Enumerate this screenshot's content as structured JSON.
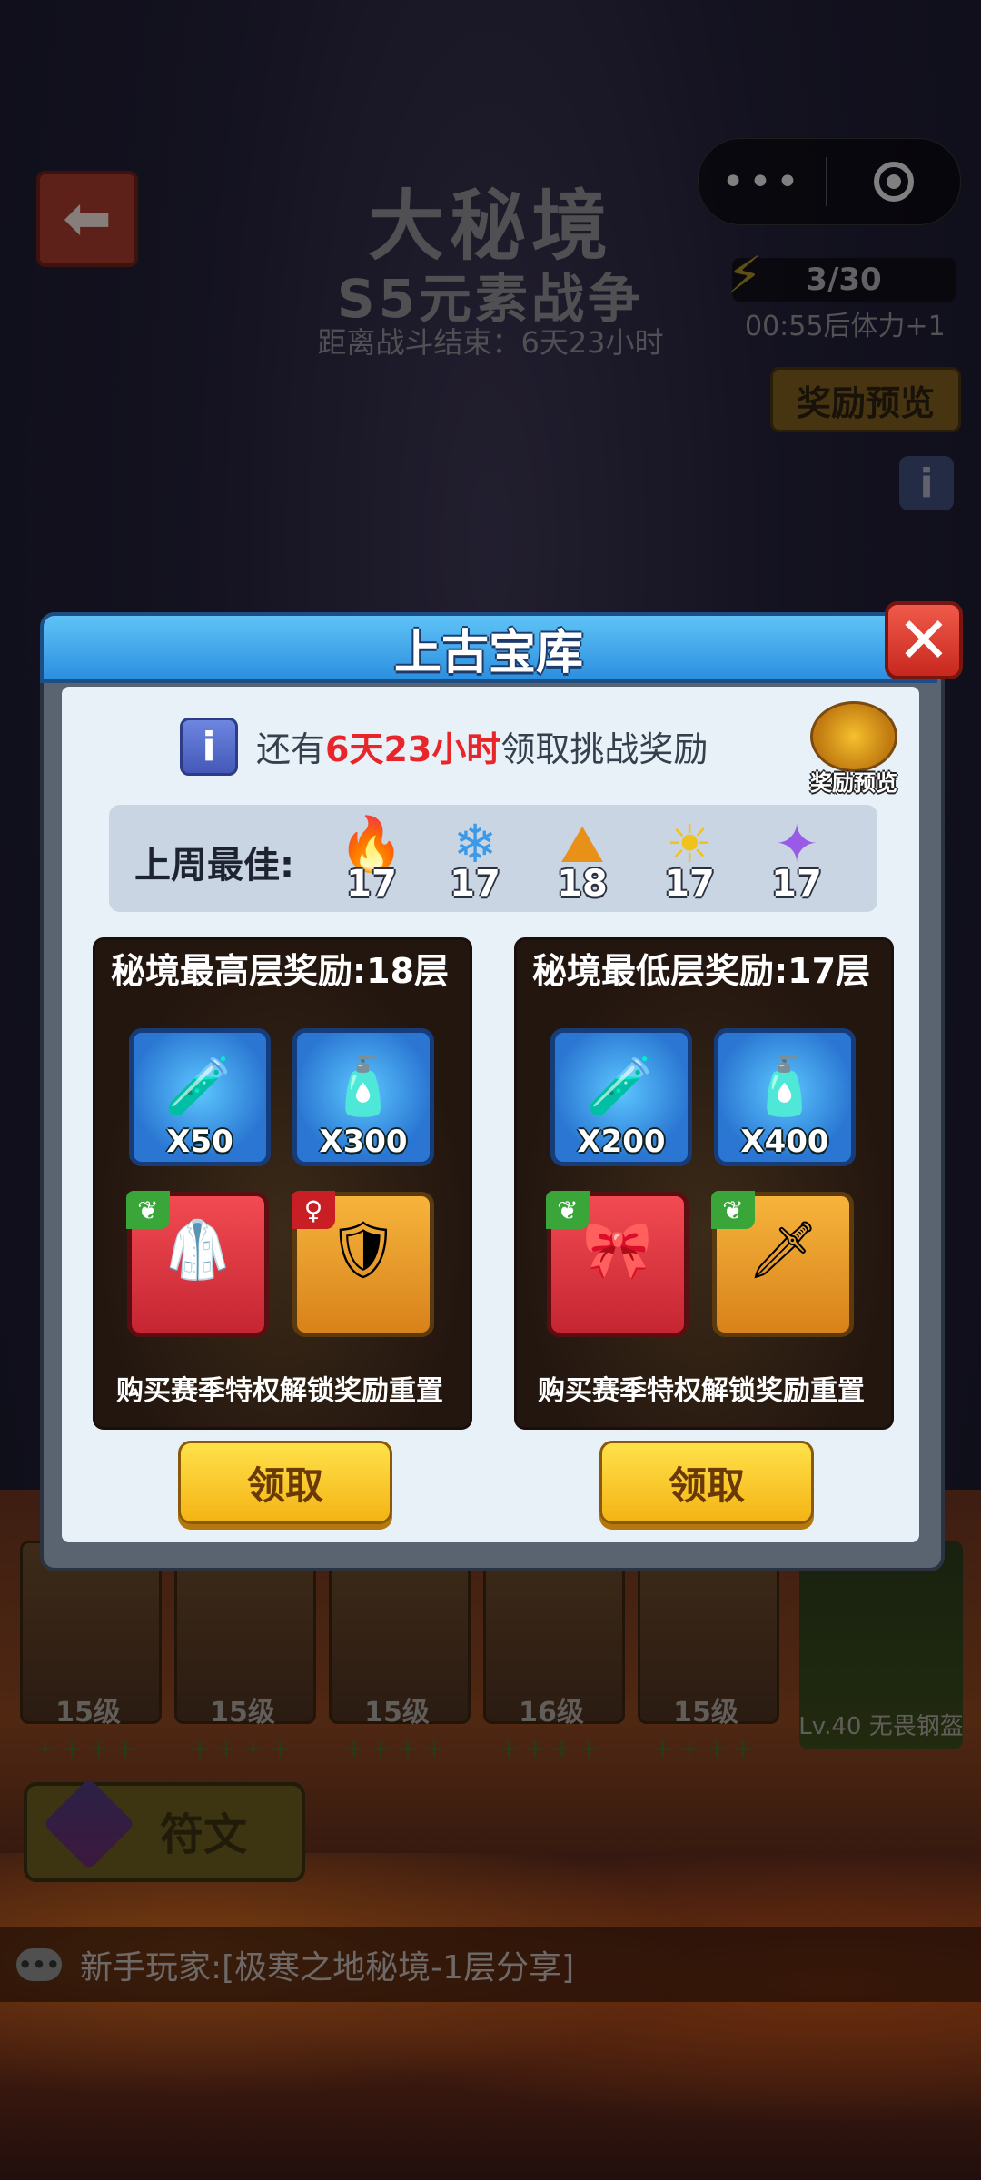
{
  "header": {
    "title": "大秘境",
    "subtitle": "S5元素战争",
    "countdown": "距离战斗结束：6天23小时",
    "energy": "3/30",
    "energy_regen": "00:55后体力+1",
    "reward_preview": "奖励预览"
  },
  "modal": {
    "title": "上古宝库",
    "notice_prefix": "还有",
    "notice_time": "6天23小时",
    "notice_suffix": "领取挑战奖励",
    "chest_label": "奖励预览",
    "best_label": "上周最佳:",
    "elements": [
      {
        "icon": "fire-icon",
        "value": "17",
        "color": "#e8372a"
      },
      {
        "icon": "snowflake-icon",
        "value": "17",
        "color": "#3a9ae8"
      },
      {
        "icon": "earth-icon",
        "value": "18",
        "color": "#e89018"
      },
      {
        "icon": "sun-icon",
        "value": "17",
        "color": "#f2c21c"
      },
      {
        "icon": "sparkle-icon",
        "value": "17",
        "color": "#9a5ae8"
      }
    ],
    "panels": [
      {
        "title": "秘境最高层奖励:18层",
        "items": [
          {
            "icon": "red-potion-icon",
            "qty": "X50"
          },
          {
            "icon": "pink-potion-icon",
            "qty": "X300"
          },
          {
            "icon": "white-cloak-icon",
            "qty": ""
          },
          {
            "icon": "armor-icon",
            "qty": ""
          }
        ],
        "footer": "购买赛季特权解锁奖励重置",
        "claim": "领取"
      },
      {
        "title": "秘境最低层奖励:17层",
        "items": [
          {
            "icon": "red-potion-icon",
            "qty": "X200"
          },
          {
            "icon": "pink-potion-icon",
            "qty": "X400"
          },
          {
            "icon": "red-ornament-icon",
            "qty": ""
          },
          {
            "icon": "sword-icon",
            "qty": ""
          }
        ],
        "footer": "购买赛季特权解锁奖励重置",
        "claim": "领取"
      }
    ]
  },
  "heroes": [
    {
      "level": "15级"
    },
    {
      "level": "15级"
    },
    {
      "level": "15级"
    },
    {
      "level": "16级"
    },
    {
      "level": "15级"
    }
  ],
  "special_unit": "Lv.40 无畏钢盔",
  "rune_button": "符文",
  "chat": "新手玩家:[极寒之地秘境-1层分享]"
}
